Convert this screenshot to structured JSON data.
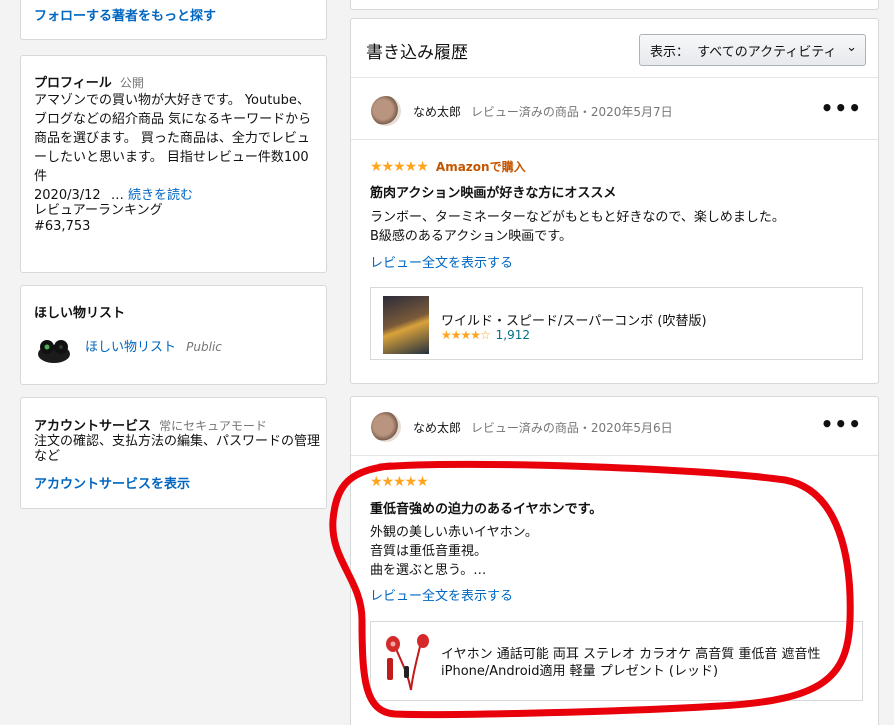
{
  "left": {
    "follow_link": "フォローする著者をもっと探す",
    "profile": {
      "heading": "プロフィール",
      "visibility": "公開",
      "bio": "アマゾンでの買い物が大好きです。 Youtube、ブログなどの紹介商品 気になるキーワードから商品を選びます。 買った商品は、全力でレビューしたいと思います。 目指せレビュー件数100件",
      "date": "2020/3/12",
      "ellipsis": "…",
      "read_more": "続きを読む",
      "ranking_label": "レビュアーランキング",
      "ranking_value": "#63,753"
    },
    "wishlist": {
      "heading": "ほしい物リスト",
      "item_label": "ほしい物リスト",
      "item_visibility": "Public"
    },
    "account": {
      "heading": "アカウントサービス",
      "subheading": "常にセキュアモード",
      "description": "注文の確認、支払方法の編集、パスワードの管理など",
      "link": "アカウントサービスを表示"
    }
  },
  "history": {
    "title": "書き込み履歴",
    "filter_label": "表示：",
    "filter_value": "すべてのアクティビティ"
  },
  "reviews": [
    {
      "author": "なめ太郎",
      "meta": "レビュー済みの商品・2020年5月7日",
      "stars": "★★★★★",
      "badge": "Amazonで購入",
      "title": "筋肉アクション映画が好きな方にオススメ",
      "body_lines": [
        "ランボー、ターミネーターなどがもともと好きなので、楽しめました。",
        "B級感のあるアクション映画です。"
      ],
      "full_link": "レビュー全文を表示する",
      "product": {
        "name": "ワイルド・スピード/スーパーコンボ (吹替版)",
        "rating_stars": "★★★★☆",
        "rating_count": "1,912"
      }
    },
    {
      "author": "なめ太郎",
      "meta": "レビュー済みの商品・2020年5月6日",
      "stars": "★★★★★",
      "title": "重低音強めの迫力のあるイヤホンです。",
      "body_lines": [
        "外観の美しい赤いイヤホン。",
        "音質は重低音重視。",
        "曲を選ぶと思う。…"
      ],
      "full_link": "レビュー全文を表示する",
      "product": {
        "name_line1": "イヤホン 通話可能 両耳 ステレオ カラオケ 高音質 重低音 遮音性",
        "name_line2": "iPhone/Android適用 軽量 プレゼント (レッド)"
      }
    }
  ],
  "colors": {
    "link": "#0066c0",
    "star": "#ffa41c",
    "badge": "#c45500",
    "annotation": "#e8000b"
  }
}
